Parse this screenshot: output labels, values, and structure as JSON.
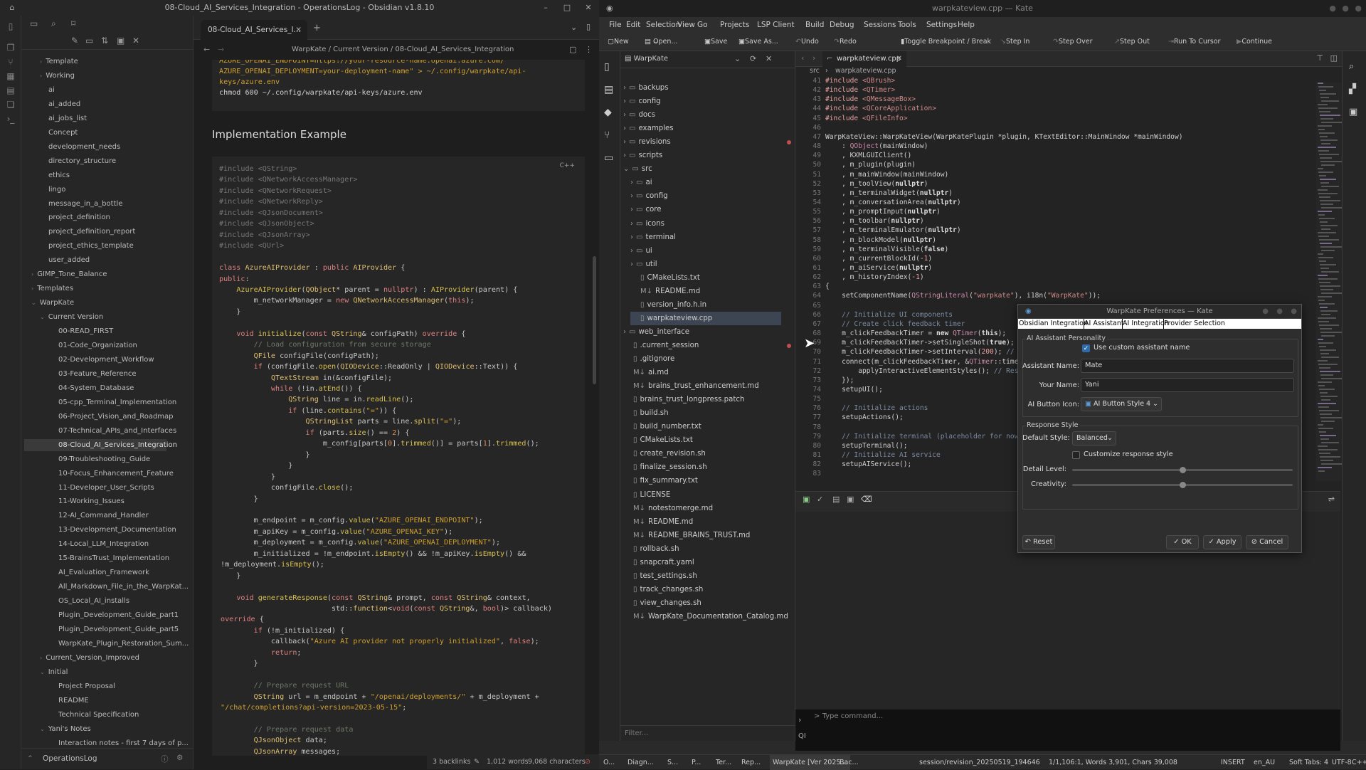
{
  "obsidian": {
    "window_title": "08-Cloud_AI_Services_Integration - OperationsLog - Obsidian v1.8.10",
    "tab_title": "08-Cloud_AI_Services_I...",
    "breadcrumb": [
      "WarpKate",
      "Current Version",
      "08-Cloud_AI_Services_Integration"
    ],
    "vault_name": "OperationsLog",
    "status": {
      "backlinks": "3 backlinks",
      "words": "1,012 words",
      "chars": "9,068 characters"
    },
    "tree": [
      {
        "label": "Template",
        "level": 2,
        "chev": "›"
      },
      {
        "label": "Working",
        "level": 2,
        "chev": "›"
      },
      {
        "label": "ai",
        "level": 2
      },
      {
        "label": "ai_added",
        "level": 2
      },
      {
        "label": "ai_jobs_list",
        "level": 2
      },
      {
        "label": "Concept",
        "level": 2
      },
      {
        "label": "development_needs",
        "level": 2
      },
      {
        "label": "directory_structure",
        "level": 2
      },
      {
        "label": "ethics",
        "level": 2
      },
      {
        "label": "lingo",
        "level": 2
      },
      {
        "label": "message_in_a_bottle",
        "level": 2
      },
      {
        "label": "project_definition",
        "level": 2
      },
      {
        "label": "project_definition_report",
        "level": 2
      },
      {
        "label": "project_ethics_template",
        "level": 2
      },
      {
        "label": "user_added",
        "level": 2
      },
      {
        "label": "GIMP_Tone_Balance",
        "level": 1,
        "chev": "›"
      },
      {
        "label": "Templates",
        "level": 1,
        "chev": "›"
      },
      {
        "label": "WarpKate",
        "level": 1,
        "chev": "⌄"
      },
      {
        "label": "Current Version",
        "level": 2,
        "chev": "⌄"
      },
      {
        "label": "00-READ_FIRST",
        "level": 3
      },
      {
        "label": "01-Code_Organization",
        "level": 3
      },
      {
        "label": "02-Development_Workflow",
        "level": 3
      },
      {
        "label": "03-Feature_Reference",
        "level": 3
      },
      {
        "label": "04-System_Database",
        "level": 3
      },
      {
        "label": "05-cpp_Terminal_Implementation",
        "level": 3
      },
      {
        "label": "06-Project_Vision_and_Roadmap",
        "level": 3
      },
      {
        "label": "07-Technical_APIs_and_Interfaces",
        "level": 3
      },
      {
        "label": "08-Cloud_AI_Services_Integration",
        "level": 3,
        "selected": true
      },
      {
        "label": "09-Troubleshooting_Guide",
        "level": 3
      },
      {
        "label": "10-Focus_Enhancement_Feature",
        "level": 3
      },
      {
        "label": "11-Developer_User_Scripts",
        "level": 3
      },
      {
        "label": "11-Working_Issues",
        "level": 3
      },
      {
        "label": "12-AI_Command_Handler",
        "level": 3
      },
      {
        "label": "13-Development_Documentation",
        "level": 3
      },
      {
        "label": "14-Local_LLM_Integration",
        "level": 3
      },
      {
        "label": "15-BrainsTrust_Implementation",
        "level": 3
      },
      {
        "label": "AI_Evaluation_Framework",
        "level": 3
      },
      {
        "label": "All_Markdown_File_in_the_WarpKat...",
        "level": 3
      },
      {
        "label": "OS_Local_AI_installs",
        "level": 3
      },
      {
        "label": "Plugin_Development_Guide_part1",
        "level": 3
      },
      {
        "label": "Plugin_Development_Guide_part5",
        "level": 3
      },
      {
        "label": "WarpKate_Plugin_Restoration_Sum...",
        "level": 3
      },
      {
        "label": "Current_Version_Improved",
        "level": 2,
        "chev": "›"
      },
      {
        "label": "Initial",
        "level": 2,
        "chev": "⌄"
      },
      {
        "label": "Project Proposal",
        "level": 3
      },
      {
        "label": "README",
        "level": 3
      },
      {
        "label": "Technical Specification",
        "level": 3
      },
      {
        "label": "Yani's Notes",
        "level": 2,
        "chev": "⌄"
      },
      {
        "label": "Interaction notes - first 7 days of p...",
        "level": 3
      }
    ],
    "top_code": [
      "AZURE_OPENAI_ENDPOINT=https://your-resource-name.openai.azure.com/",
      "AZURE_OPENAI_DEPLOYMENT=your-deployment-name\" > ~/.config/warpkate/api-",
      "keys/azure.env",
      "chmod 600 ~/.config/warpkate/api-keys/azure.env"
    ],
    "heading": "Implementation Example",
    "code_lang": "C++"
  },
  "kate": {
    "window_title": "warpkateview.cpp — Kate",
    "menu": [
      "File",
      "Edit",
      "Selection",
      "View",
      "Go",
      "Projects",
      "LSP Client",
      "Build",
      "Debug",
      "Sessions",
      "Tools",
      "Settings",
      "Help"
    ],
    "toolbar": {
      "new": "New",
      "open": "Open...",
      "save": "Save",
      "save_as": "Save As...",
      "undo": "Undo",
      "redo": "Redo",
      "toggle_bp": "Toggle Breakpoint / Break",
      "step_in": "Step In",
      "step_over": "Step Over",
      "step_out": "Step Out",
      "run_to_cursor": "Run To Cursor",
      "continue": "Continue"
    },
    "project_name": "WarpKate",
    "filter_placeholder": "Filter...",
    "file_tab": "warpkateview.cpp",
    "crumb": [
      "src",
      "warpkateview.cpp"
    ],
    "terminal_placeholder": "Type command...",
    "status": {
      "session": "session/revision_20250519_194646",
      "position": "1/1,106:1, Words 3,901, Chars 39,008",
      "mode": "INSERT",
      "lang": "en_AU",
      "tabs": "Soft Tabs: 4",
      "enc": "UTF-8",
      "syntax": "C++",
      "task": "WarpKate [Ver 2025..."
    },
    "status_tabs": [
      "O...",
      "Diagn...",
      "S...",
      "P...",
      "Ter...",
      "Rep...",
      "Bac..."
    ]
  },
  "dialog": {
    "title": "WarpKate Preferences — Kate",
    "tabs": [
      "Obsidian Integration",
      "AI Assistant",
      "AI Integration",
      "Provider Selection"
    ],
    "group1": "AI Assistant Personality",
    "use_custom_name": "Use custom assistant name",
    "assistant_name_label": "Assistant Name:",
    "assistant_name": "Mate",
    "your_name_label": "Your Name:",
    "your_name": "Yani",
    "button_icon_label": "AI Button Icon:",
    "button_icon": "AI Button Style 4",
    "group2": "Response Style",
    "default_style_label": "Default Style:",
    "default_style": "Balanced",
    "customize": "Customize response style",
    "detail_label": "Detail Level:",
    "detail_value": 0.5,
    "creativity_label": "Creativity:",
    "creativity_value": 0.5,
    "reset": "Reset",
    "ok": "OK",
    "apply": "Apply",
    "cancel": "Cancel"
  }
}
